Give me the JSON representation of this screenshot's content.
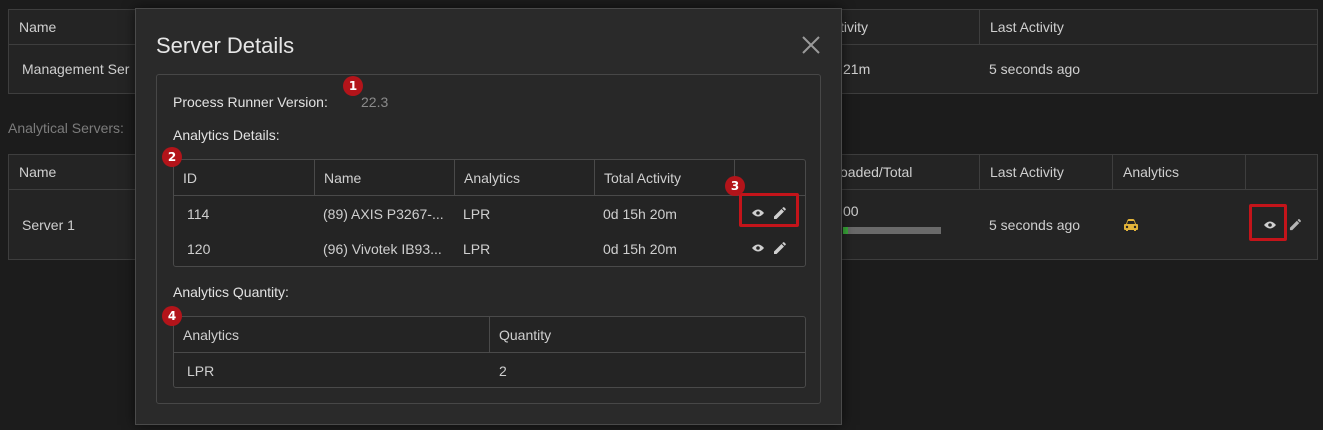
{
  "background": {
    "management_table": {
      "headers": [
        "Name",
        "tivity",
        "Last Activity"
      ],
      "row": {
        "name": "Management Ser",
        "activity": "21m",
        "last_activity": "5 seconds ago"
      }
    },
    "analytical_label": "Analytical Servers:",
    "servers_table": {
      "headers": [
        "Name",
        "oaded/Total",
        "Last Activity",
        "Analytics"
      ],
      "row": {
        "name": "Server 1",
        "loaded": "00",
        "progress_fraction": 0.05,
        "last_activity": "5 seconds ago",
        "analytics_icon": "car-icon",
        "view_icon": "eye-icon",
        "edit_icon": "pencil-icon"
      }
    }
  },
  "modal": {
    "title": "Server Details",
    "close_icon": "close-icon",
    "process_runner_label": "Process Runner Version:",
    "process_runner_value": "22.3",
    "analytics_details_label": "Analytics Details:",
    "details_table": {
      "headers": [
        "ID",
        "Name",
        "Analytics",
        "Total Activity"
      ],
      "rows": [
        {
          "id": "114",
          "name": "(89) AXIS P3267-...",
          "analytics": "LPR",
          "total_activity": "0d 15h 20m"
        },
        {
          "id": "120",
          "name": "(96) Vivotek IB93...",
          "analytics": "LPR",
          "total_activity": "0d 15h 20m"
        }
      ]
    },
    "analytics_quantity_label": "Analytics Quantity:",
    "quantity_table": {
      "headers": [
        "Analytics",
        "Quantity"
      ],
      "rows": [
        {
          "analytics": "LPR",
          "quantity": "2"
        }
      ]
    }
  },
  "badges": [
    "1",
    "2",
    "3",
    "4"
  ],
  "colors": {
    "accent_red": "#b3141a",
    "progress_green": "#3cae3c",
    "car_yellow": "#e3b43a"
  }
}
